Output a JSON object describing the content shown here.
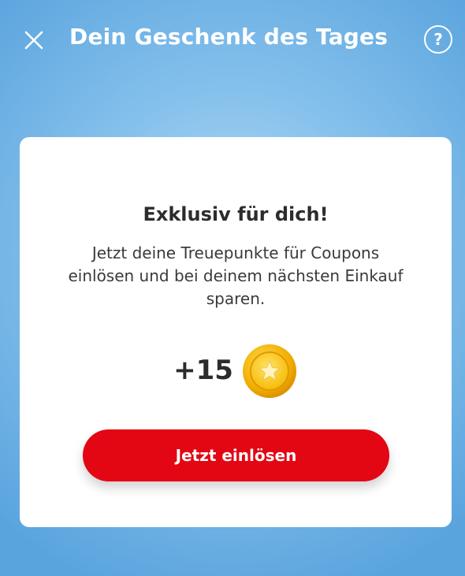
{
  "header": {
    "title": "Dein Geschenk des Tages",
    "close_icon": "close-icon",
    "help_icon": "question-mark-icon",
    "help_symbol": "?"
  },
  "card": {
    "title": "Exklusiv für dich!",
    "text": "Jetzt deine Treuepunkte für Coupons einlösen und bei deinem nächsten Einkauf sparen.",
    "points": "+15",
    "coin_icon": "star-coin-icon",
    "button_label": "Jetzt einlösen"
  },
  "colors": {
    "background": "#86c1ec",
    "card": "#ffffff",
    "cta": "#e30613",
    "coin": "#f2b807"
  }
}
